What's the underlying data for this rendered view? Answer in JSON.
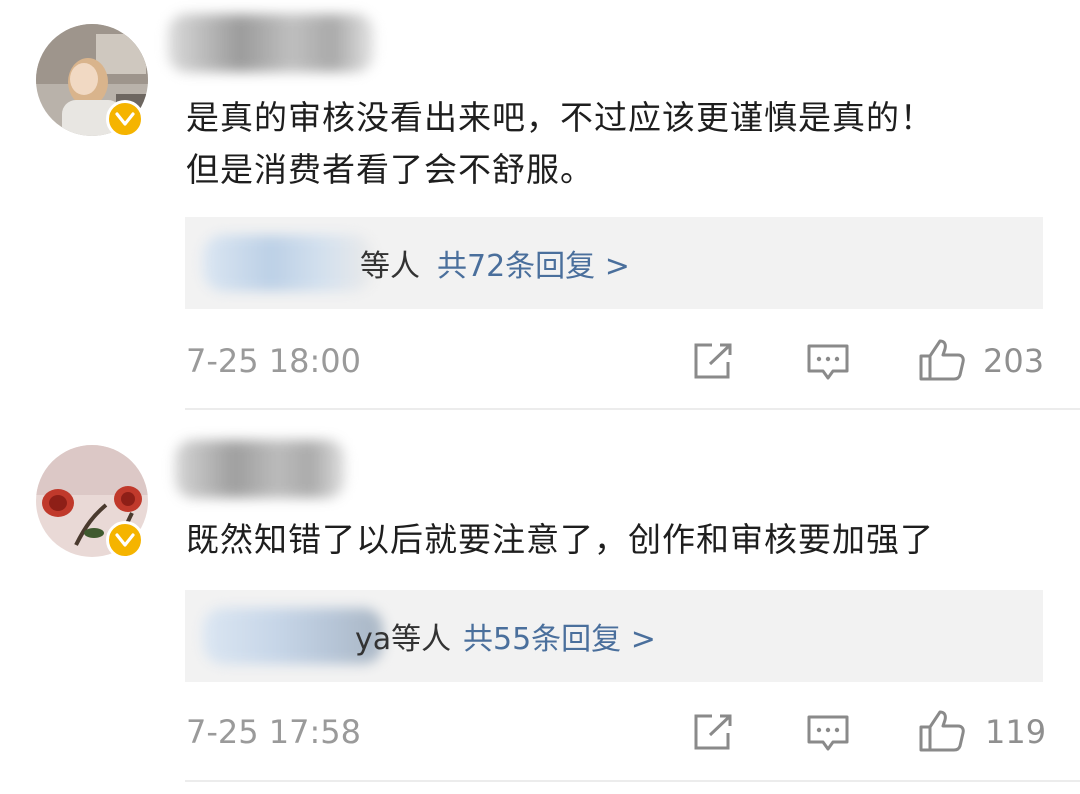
{
  "comments": [
    {
      "text_line1": "是真的审核没看出来吧，不过应该更谨慎是真的！",
      "text_line2": "但是消费者看了会不舒服。",
      "reply_users_suffix": "等人",
      "reply_count_label": "共72条回复 >",
      "time": "7-25 18:00",
      "likes": "203"
    },
    {
      "text_line1": "既然知错了以后就要注意了，创作和审核要加强了",
      "reply_users_suffix": "ya等人",
      "reply_count_label": "共55条回复 >",
      "time": "7-25 17:58",
      "likes": "119"
    }
  ],
  "colors": {
    "reply_link": "#4a6f9c",
    "verified_badge": "#f5b400",
    "reply_bg": "#f2f2f2"
  },
  "icons": [
    "share-icon",
    "comment-icon",
    "like-icon",
    "verified-badge-icon"
  ]
}
